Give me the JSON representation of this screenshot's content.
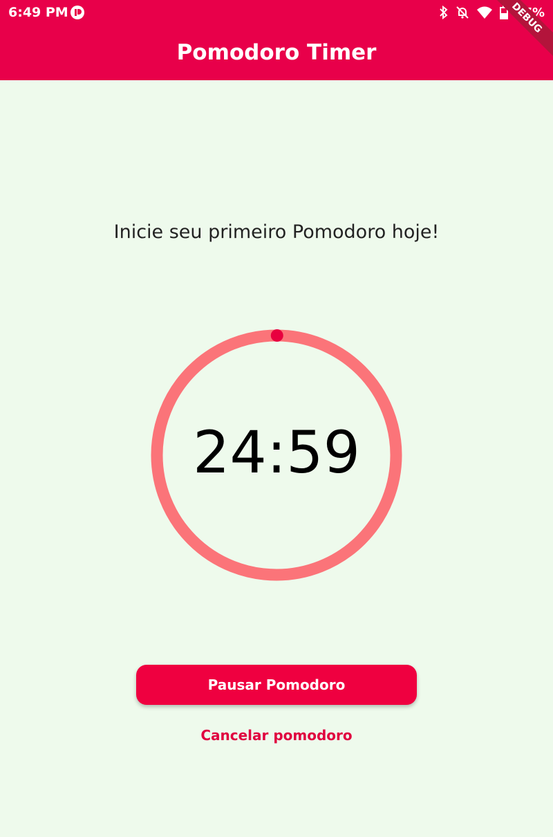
{
  "status_bar": {
    "time": "6:49 PM",
    "battery_label": "47%",
    "icons": [
      "notification-app-icon",
      "bluetooth-icon",
      "notifications-off-icon",
      "wifi-icon",
      "battery-icon"
    ]
  },
  "app_bar": {
    "title": "Pomodoro Timer",
    "debug_banner": "DEBUG",
    "color": "#e8004a"
  },
  "main": {
    "subtitle": "Inicie seu primeiro Pomodoro hoje!",
    "timer": {
      "display": "24:59",
      "ring_color": "#fb7479",
      "indicator_color": "#e8003f",
      "progress_fraction": 0.0007
    },
    "pause_button_label": "Pausar Pomodoro",
    "cancel_link_label": "Cancelar pomodoro"
  }
}
